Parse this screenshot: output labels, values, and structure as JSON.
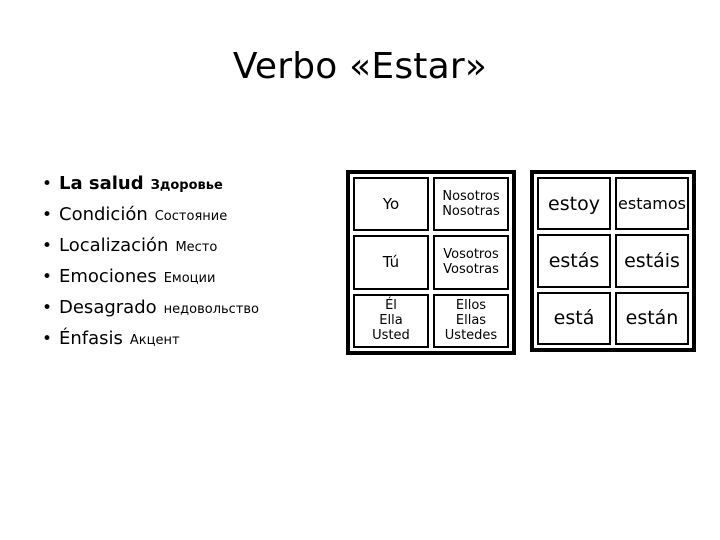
{
  "slide": {
    "title": "Verbo «Estar»"
  },
  "uses": {
    "bullet_glyph": "•",
    "items": [
      {
        "term": "La salud",
        "gloss": "Здоровье",
        "bold": true
      },
      {
        "term": "Condición",
        "gloss": "Состояние",
        "bold": false
      },
      {
        "term": "Localización",
        "gloss": "Место",
        "bold": false
      },
      {
        "term": "Emociones",
        "gloss": "Емоции",
        "bold": false
      },
      {
        "term": "Desagrado",
        "gloss": "недовольство",
        "bold": false
      },
      {
        "term": "Énfasis",
        "gloss": "Акцент",
        "bold": false
      }
    ]
  },
  "pronoun_table": {
    "rows": [
      {
        "singular": [
          "Yo"
        ],
        "plural": [
          "Nosotros",
          "Nosotras"
        ]
      },
      {
        "singular": [
          "Tú"
        ],
        "plural": [
          "Vosotros",
          "Vosotras"
        ]
      },
      {
        "singular": [
          "Él",
          "Ella",
          "Usted"
        ],
        "plural": [
          "Ellos",
          "Ellas",
          "Ustedes"
        ]
      }
    ]
  },
  "conjugation_table": {
    "rows": [
      {
        "singular": "estoy",
        "plural": "estamos"
      },
      {
        "singular": "estás",
        "plural": "estáis"
      },
      {
        "singular": "está",
        "plural": "están"
      }
    ]
  },
  "colors": {
    "text": "#000000",
    "background": "#ffffff",
    "border": "#000000"
  }
}
